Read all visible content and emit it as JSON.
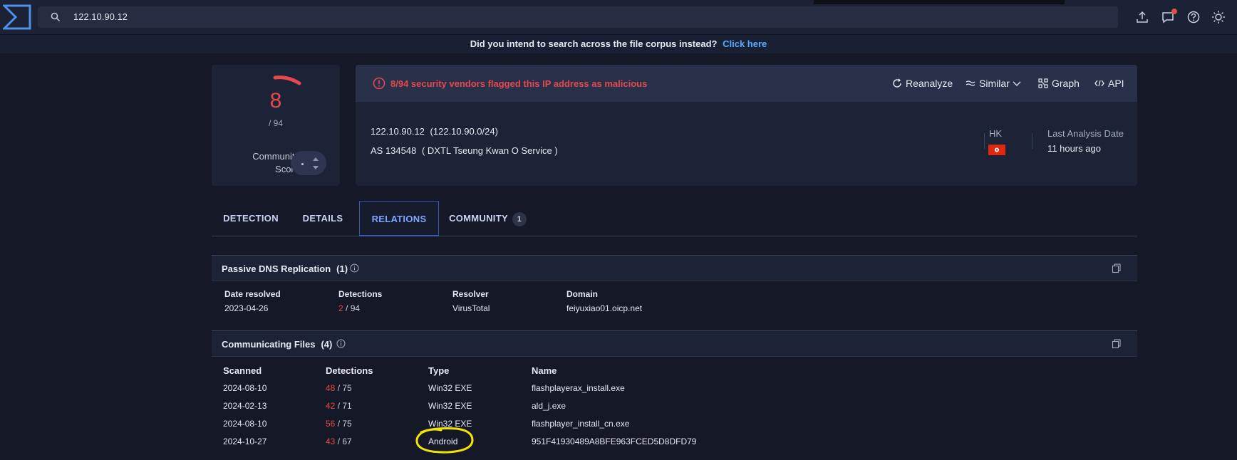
{
  "search": {
    "value": "122.10.90.12"
  },
  "banner": {
    "text": "Did you intend to search across the file corpus instead?",
    "link": "Click here"
  },
  "score": {
    "detections": "8",
    "total": "/ 94",
    "community_label_1": "Community",
    "community_label_2": "Score"
  },
  "alert": {
    "text": "8/94 security vendors flagged this IP address as malicious"
  },
  "actions": {
    "reanalyze": "Reanalyze",
    "similar": "Similar",
    "graph": "Graph",
    "api": "API"
  },
  "ip_info": {
    "ip": "122.10.90.12",
    "range": "(122.10.90.0/24)",
    "as": "AS 134548",
    "as_name": "( DXTL Tseung Kwan O Service )",
    "country": "HK",
    "last_analysis_label": "Last Analysis Date",
    "last_analysis_value": "11 hours ago"
  },
  "tabs": [
    {
      "label": "DETECTION"
    },
    {
      "label": "DETAILS"
    },
    {
      "label": "RELATIONS"
    },
    {
      "label": "COMMUNITY",
      "badge": "1"
    }
  ],
  "passive_dns": {
    "title": "Passive DNS Replication",
    "count": "(1)",
    "headers": [
      "Date resolved",
      "Detections",
      "Resolver",
      "Domain"
    ],
    "rows": [
      {
        "date": "2023-04-26",
        "det": "2",
        "total": "/ 94",
        "resolver": "VirusTotal",
        "domain": "feiyuxiao01.oicp.net"
      }
    ]
  },
  "comm_files": {
    "title": "Communicating Files",
    "count": "(4)",
    "headers": [
      "Scanned",
      "Detections",
      "Type",
      "Name"
    ],
    "rows": [
      {
        "scanned": "2024-08-10",
        "det": "48",
        "total": "/ 75",
        "type": "Win32 EXE",
        "name": "flashplayerax_install.exe"
      },
      {
        "scanned": "2024-02-13",
        "det": "42",
        "total": "/ 71",
        "type": "Win32 EXE",
        "name": "ald_j.exe"
      },
      {
        "scanned": "2024-08-10",
        "det": "56",
        "total": "/ 75",
        "type": "Win32 EXE",
        "name": "flashplayer_install_cn.exe"
      },
      {
        "scanned": "2024-10-27",
        "det": "43",
        "total": "/ 67",
        "type": "Android",
        "name": "951F41930489A8BFE963FCED5D8DFD79"
      }
    ]
  },
  "colors": {
    "malicious": "#e5484d",
    "link": "#5aa9ff",
    "active_tab": "#7da6ff",
    "annotation": "#f5e400"
  }
}
